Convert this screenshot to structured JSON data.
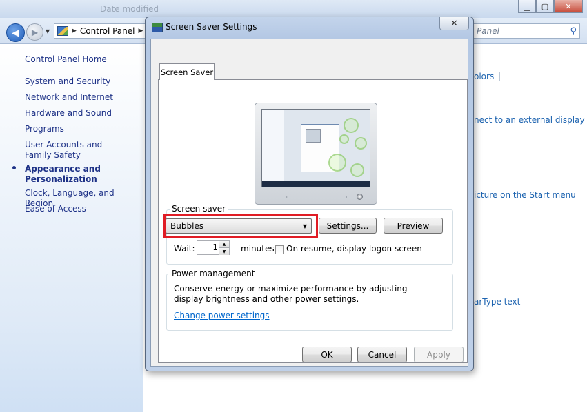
{
  "control_panel": {
    "title_ghost": "Date modified",
    "address": "Control Panel",
    "search_placeholder": "Panel",
    "sidebar": {
      "home": "Control Panel Home",
      "items": [
        {
          "label": "System and Security"
        },
        {
          "label": "Network and Internet"
        },
        {
          "label": "Hardware and Sound"
        },
        {
          "label": "Programs"
        },
        {
          "label": "User Accounts and Family Safety"
        },
        {
          "label": "Appearance and Personalization",
          "active": true
        },
        {
          "label": "Clock, Language, and Region"
        },
        {
          "label": "Ease of Access"
        }
      ]
    },
    "main_links": [
      "olors",
      "nect to an external display",
      "icture on the Start menu",
      "arType text"
    ]
  },
  "dialog": {
    "title": "Screen Saver Settings",
    "close_glyph": "✕",
    "tab_label": "Screen Saver",
    "screen_saver": {
      "group_label": "Screen saver",
      "selected": "Bubbles",
      "settings_button": "Settings...",
      "preview_button": "Preview",
      "wait_label": "Wait:",
      "wait_value": "1",
      "minutes_label": "minutes",
      "resume_label": "On resume, display logon screen",
      "resume_checked": false
    },
    "power": {
      "group_label": "Power management",
      "description": "Conserve energy or maximize performance by adjusting display brightness and other power settings.",
      "link": "Change power settings"
    },
    "buttons": {
      "ok": "OK",
      "cancel": "Cancel",
      "apply": "Apply"
    }
  },
  "colors": {
    "highlight": "#e01c24",
    "link": "#0066cc",
    "nav_text": "#1e3287"
  }
}
